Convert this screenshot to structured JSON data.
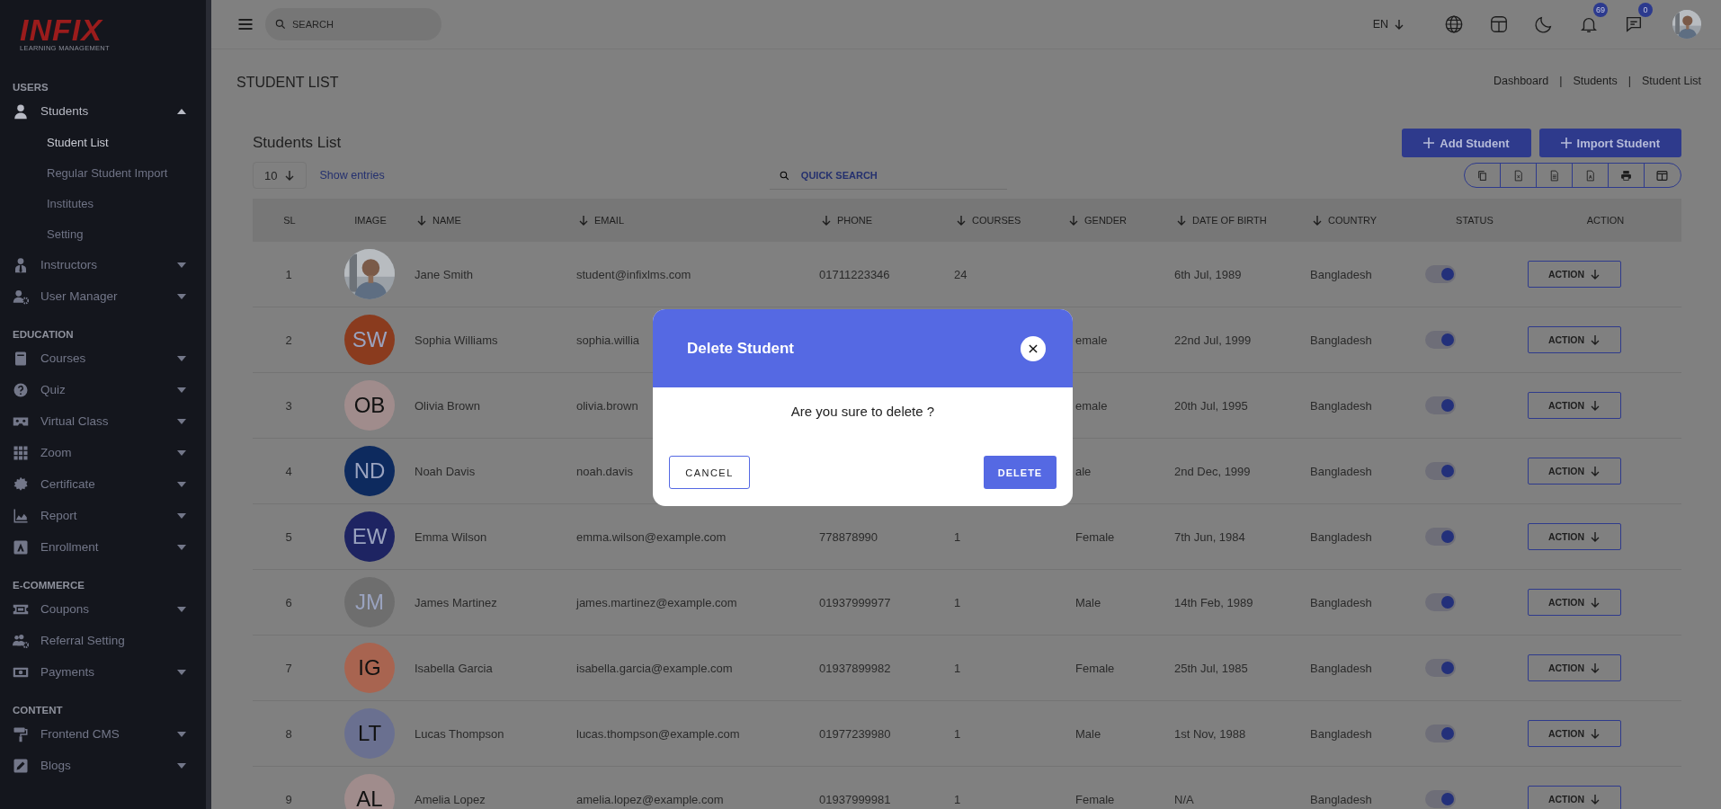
{
  "sidebar": {
    "logo": {
      "brand": "INFIX",
      "tagline": "LEARNING MANAGEMENT"
    },
    "sections": [
      {
        "heading": "USERS",
        "items": [
          {
            "label": "Students",
            "kind": "group",
            "expanded": true,
            "children": [
              {
                "label": "Student List",
                "selected": true
              },
              {
                "label": "Regular Student Import",
                "selected": false
              },
              {
                "label": "Institutes",
                "selected": false
              },
              {
                "label": "Setting",
                "selected": false
              }
            ]
          },
          {
            "label": "Instructors",
            "kind": "group",
            "expanded": false
          },
          {
            "label": "User Manager",
            "kind": "group",
            "expanded": false
          }
        ]
      },
      {
        "heading": "EDUCATION",
        "items": [
          {
            "label": "Courses",
            "kind": "group",
            "expanded": false
          },
          {
            "label": "Quiz",
            "kind": "group",
            "expanded": false
          },
          {
            "label": "Virtual Class",
            "kind": "group",
            "expanded": false
          },
          {
            "label": "Zoom",
            "kind": "group",
            "expanded": false
          },
          {
            "label": "Certificate",
            "kind": "group",
            "expanded": false
          },
          {
            "label": "Report",
            "kind": "group",
            "expanded": false
          },
          {
            "label": "Enrollment",
            "kind": "group",
            "expanded": false
          }
        ]
      },
      {
        "heading": "E-COMMERCE",
        "items": [
          {
            "label": "Coupons",
            "kind": "group",
            "expanded": false
          },
          {
            "label": "Referral Setting",
            "kind": "link"
          },
          {
            "label": "Payments",
            "kind": "group",
            "expanded": false
          }
        ]
      },
      {
        "heading": "CONTENT",
        "items": [
          {
            "label": "Frontend CMS",
            "kind": "group",
            "expanded": false
          },
          {
            "label": "Blogs",
            "kind": "group",
            "expanded": false
          }
        ]
      }
    ]
  },
  "topbar": {
    "search": {
      "placeholder": "SEARCH"
    },
    "language": "EN",
    "notifications": "69",
    "messages": "0"
  },
  "page": {
    "title": "STUDENT LIST",
    "breadcrumb": [
      "Dashboard",
      "Students",
      "Student List"
    ],
    "separator": "|"
  },
  "card": {
    "title": "Students List",
    "buttons": [
      "Add Student",
      "Import Student"
    ],
    "entries": "10",
    "entries_label": "Show entries",
    "quick_search": {
      "placeholder": "QUICK SEARCH"
    }
  },
  "table": {
    "columns": [
      {
        "label": "SL",
        "sortable": false
      },
      {
        "label": "IMAGE",
        "sortable": false
      },
      {
        "label": "NAME",
        "sortable": true
      },
      {
        "label": "EMAIL",
        "sortable": true
      },
      {
        "label": "PHONE",
        "sortable": true
      },
      {
        "label": "COURSES",
        "sortable": true
      },
      {
        "label": "GENDER",
        "sortable": true
      },
      {
        "label": "DATE OF BIRTH",
        "sortable": true
      },
      {
        "label": "COUNTRY",
        "sortable": true
      },
      {
        "label": "STATUS",
        "sortable": false
      },
      {
        "label": "ACTION",
        "sortable": false
      }
    ],
    "rows": [
      {
        "sl": "1",
        "name": "Jane Smith",
        "email": "student@infixlms.com",
        "phone": "01711223346",
        "courses": "24",
        "dob": "6th Jul, 1989",
        "country": "Bangladesh",
        "status": true,
        "action": "ACTION"
      },
      {
        "sl": "2",
        "image": {
          "initials": "SW",
          "color": "#8a3b1e"
        },
        "name": "Sophia Williams",
        "email": "sophia.willia",
        "gender": "emale",
        "dob": "22nd Jul, 1999",
        "country": "Bangladesh",
        "status": true,
        "action": "ACTION"
      },
      {
        "sl": "3",
        "image": {
          "initials": "OB",
          "color": "#a08c8c"
        },
        "name": "Olivia Brown",
        "email": "olivia.brown",
        "gender": "emale",
        "dob": "20th Jul, 1995",
        "country": "Bangladesh",
        "status": true,
        "action": "ACTION"
      },
      {
        "sl": "4",
        "image": {
          "initials": "ND",
          "color": "#0d2a5e"
        },
        "name": "Noah Davis",
        "email": "noah.davis",
        "gender": "ale",
        "dob": "2nd Dec, 1999",
        "country": "Bangladesh",
        "status": true,
        "action": "ACTION"
      },
      {
        "sl": "5",
        "image": {
          "initials": "EW",
          "color": "#1e2462"
        },
        "name": "Emma Wilson",
        "email": "emma.wilson@example.com",
        "phone": "778878990",
        "courses": "1",
        "gender": "Female",
        "dob": "7th Jun, 1984",
        "country": "Bangladesh",
        "status": true,
        "action": "ACTION"
      },
      {
        "sl": "6",
        "image": {
          "initials": "JM",
          "color": "#6e6e6e"
        },
        "name": "James Martinez",
        "email": "james.martinez@example.com",
        "phone": "01937999977",
        "courses": "1",
        "gender": "Male",
        "dob": "14th Feb, 1989",
        "country": "Bangladesh",
        "status": true,
        "action": "ACTION"
      },
      {
        "sl": "7",
        "image": {
          "initials": "IG",
          "color": "#a86450"
        },
        "name": "Isabella Garcia",
        "email": "isabella.garcia@example.com",
        "phone": "01937899982",
        "courses": "1",
        "gender": "Female",
        "dob": "25th Jul, 1985",
        "country": "Bangladesh",
        "status": true,
        "action": "ACTION"
      },
      {
        "sl": "8",
        "image": {
          "initials": "LT",
          "color": "#6a7090"
        },
        "name": "Lucas Thompson",
        "email": "lucas.thompson@example.com",
        "phone": "01977239980",
        "courses": "1",
        "gender": "Male",
        "dob": "1st Nov, 1988",
        "country": "Bangladesh",
        "status": true,
        "action": "ACTION"
      },
      {
        "sl": "9",
        "image": {
          "initials": "AL",
          "color": "#a08c8c"
        },
        "name": "Amelia Lopez",
        "email": "amelia.lopez@example.com",
        "phone": "01937999981",
        "courses": "1",
        "gender": "Female",
        "dob": "N/A",
        "country": "Bangladesh",
        "status": true,
        "action": "ACTION"
      }
    ]
  },
  "modal": {
    "title": "Delete Student",
    "message": "Are you sure to delete ?",
    "cancel": "CANCEL",
    "confirm": "DELETE"
  }
}
